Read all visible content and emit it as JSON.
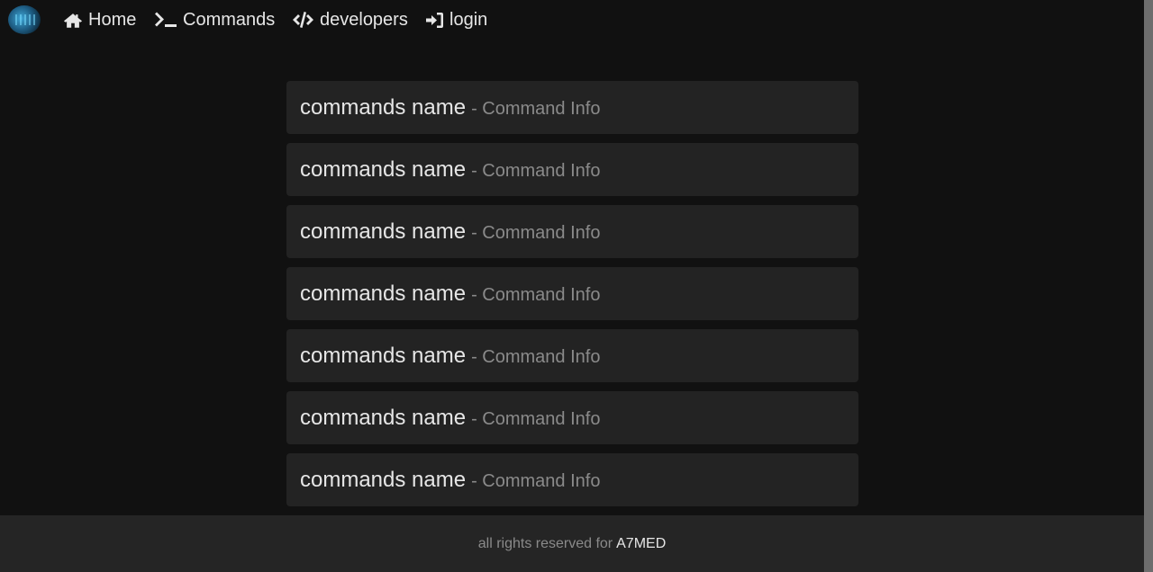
{
  "nav": {
    "home": "Home",
    "commands": "Commands",
    "developers": "developers",
    "login": "login"
  },
  "commands": [
    {
      "name": "commands name",
      "info": "- Command Info"
    },
    {
      "name": "commands name",
      "info": "- Command Info"
    },
    {
      "name": "commands name",
      "info": "- Command Info"
    },
    {
      "name": "commands name",
      "info": "- Command Info"
    },
    {
      "name": "commands name",
      "info": "- Command Info"
    },
    {
      "name": "commands name",
      "info": "- Command Info"
    },
    {
      "name": "commands name",
      "info": "- Command Info"
    }
  ],
  "footer": {
    "text": "all rights reserved for",
    "author": "A7MED"
  },
  "colors": {
    "background": "#111111",
    "card": "#232323",
    "footer": "#252525",
    "muted_text": "#8a8a8a"
  },
  "icons": [
    "home-icon",
    "terminal-icon",
    "code-icon",
    "sign-in-icon"
  ]
}
